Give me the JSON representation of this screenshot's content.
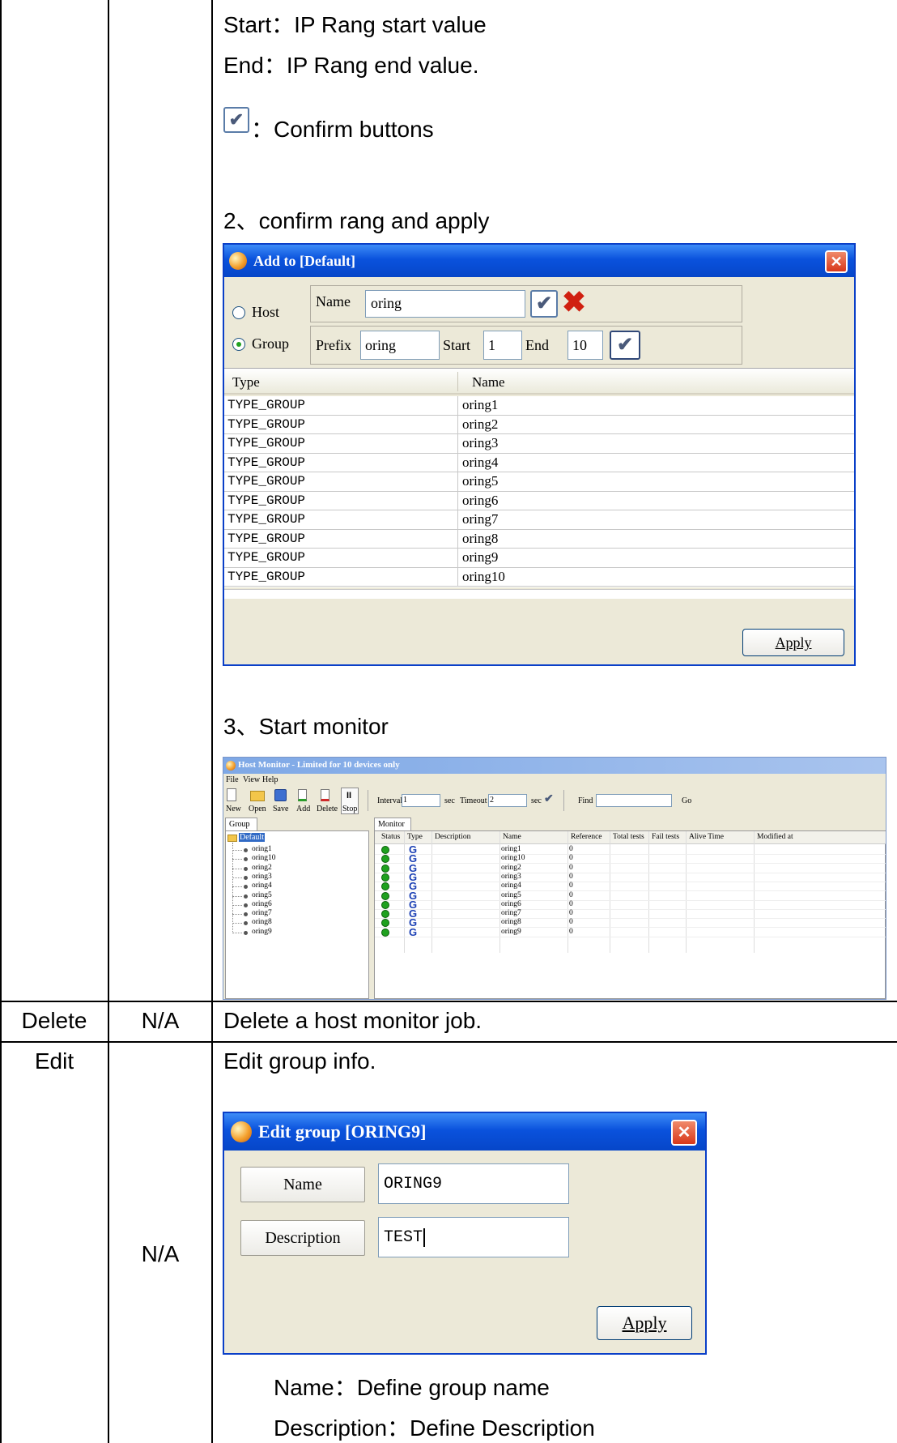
{
  "intro": {
    "start_line": "Start：IP Rang start value",
    "end_line": "End：IP Rang end value.",
    "confirm_label": "：Confirm buttons",
    "step2": "2、confirm rang and apply",
    "step3": "3、Start monitor"
  },
  "add_dialog": {
    "title": "Add to [Default]",
    "host_label": "Host",
    "group_label": "Group",
    "selected_mode": "Group",
    "name_label": "Name",
    "name_value": "oring",
    "prefix_label": "Prefix",
    "prefix_value": "oring",
    "start_label": "Start",
    "start_value": "1",
    "end_label": "End",
    "end_value": "10",
    "col_type": "Type",
    "col_name": "Name",
    "rows": [
      {
        "type": "TYPE_GROUP",
        "name": "oring1"
      },
      {
        "type": "TYPE_GROUP",
        "name": "oring2"
      },
      {
        "type": "TYPE_GROUP",
        "name": "oring3"
      },
      {
        "type": "TYPE_GROUP",
        "name": "oring4"
      },
      {
        "type": "TYPE_GROUP",
        "name": "oring5"
      },
      {
        "type": "TYPE_GROUP",
        "name": "oring6"
      },
      {
        "type": "TYPE_GROUP",
        "name": "oring7"
      },
      {
        "type": "TYPE_GROUP",
        "name": "oring8"
      },
      {
        "type": "TYPE_GROUP",
        "name": "oring9"
      },
      {
        "type": "TYPE_GROUP",
        "name": "oring10"
      }
    ],
    "apply_label": "Apply"
  },
  "monitor_window": {
    "title": "Host Monitor - Limited for 10 devices only",
    "menu": [
      "File",
      "View",
      "Help"
    ],
    "toolbar": [
      "New",
      "Open",
      "Save",
      "Add",
      "Delete",
      "Stop"
    ],
    "interval_label": "Interval",
    "interval_value": "1",
    "sec_label": "sec",
    "timeout_label": "Timeout",
    "timeout_value": "2",
    "find_label": "Find",
    "go_label": "Go",
    "group_tab": "Group",
    "monitor_tab": "Monitor",
    "tree_root": "Default",
    "tree_items": [
      "oring1",
      "oring10",
      "oring2",
      "oring3",
      "oring4",
      "oring5",
      "oring6",
      "oring7",
      "oring8",
      "oring9"
    ],
    "columns": [
      "Status",
      "Type",
      "Description",
      "Name",
      "Reference",
      "Total tests",
      "Fail tests",
      "Alive Time",
      "Modified at"
    ],
    "rows": [
      {
        "type": "G",
        "name": "oring1",
        "reference": "0"
      },
      {
        "type": "G",
        "name": "oring10",
        "reference": "0"
      },
      {
        "type": "G",
        "name": "oring2",
        "reference": "0"
      },
      {
        "type": "G",
        "name": "oring3",
        "reference": "0"
      },
      {
        "type": "G",
        "name": "oring4",
        "reference": "0"
      },
      {
        "type": "G",
        "name": "oring5",
        "reference": "0"
      },
      {
        "type": "G",
        "name": "oring6",
        "reference": "0"
      },
      {
        "type": "G",
        "name": "oring7",
        "reference": "0"
      },
      {
        "type": "G",
        "name": "oring8",
        "reference": "0"
      },
      {
        "type": "G",
        "name": "oring9",
        "reference": "0"
      }
    ]
  },
  "table": {
    "delete_row": {
      "name": "Delete",
      "value": "N/A",
      "desc": "Delete a host monitor job."
    },
    "edit_row": {
      "name": "Edit",
      "value": "N/A",
      "desc": "Edit group info."
    }
  },
  "edit_dialog": {
    "title": "Edit group [ORING9]",
    "name_label": "Name",
    "name_value": "ORING9",
    "description_label": "Description",
    "description_value": "TEST",
    "apply_label": "Apply"
  },
  "notes": {
    "name_line": "Name：Define group name",
    "description_line": "Description：Define Description"
  }
}
